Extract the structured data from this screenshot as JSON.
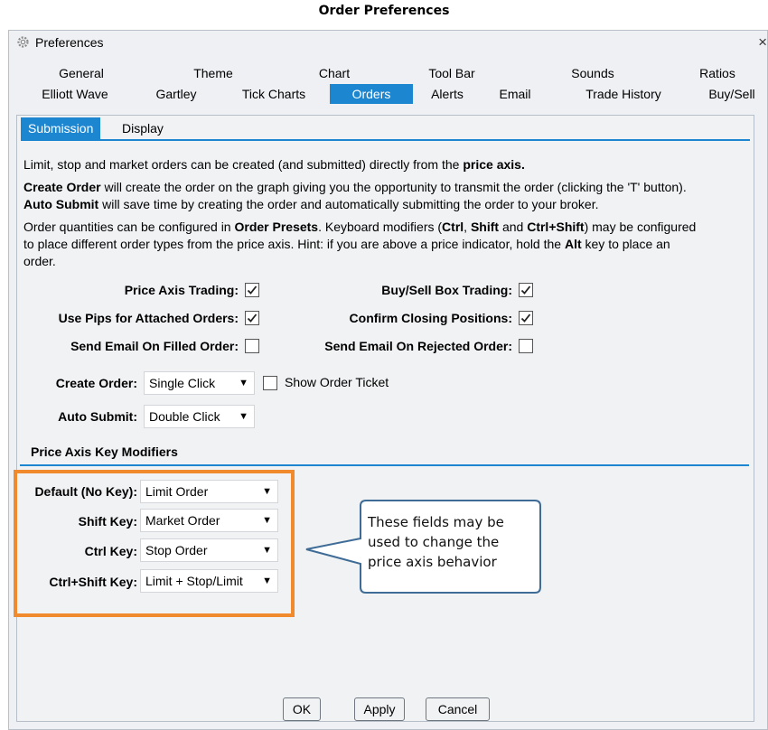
{
  "caption": "Order Preferences",
  "window": {
    "title": "Preferences",
    "close_label": "×"
  },
  "tabs_row1": [
    "General",
    "Theme",
    "Chart",
    "Tool Bar",
    "Sounds",
    "Ratios"
  ],
  "tabs_row2": [
    "Elliott Wave",
    "Gartley",
    "Tick Charts",
    "Orders",
    "Alerts",
    "Email",
    "Trade History",
    "Buy/Sell"
  ],
  "active_tab": "Orders",
  "subtabs": [
    "Submission",
    "Display"
  ],
  "active_subtab": "Submission",
  "para1": {
    "pre": "Limit, stop and market orders can be created (and submitted) directly from the ",
    "bold": "price axis."
  },
  "para2": {
    "b1": "Create Order",
    "t1": " will create the order on the graph giving you the opportunity to transmit the order (clicking the 'T' button).",
    "b2": "Auto Submit",
    "t2": " will save time by creating the order and automatically submitting the order to your broker."
  },
  "para3": {
    "t1": "Order quantities can be configured in ",
    "b1": "Order Presets",
    "t2": ". Keyboard modifiers (",
    "b2": "Ctrl",
    "t3": ", ",
    "b3": "Shift",
    "t4": " and ",
    "b4": "Ctrl+Shift",
    "t5": ") may be configured",
    "t6": "to place different order types from the price axis. Hint: if you are above a price indicator, hold the ",
    "b5": "Alt",
    "t7": " key to place an",
    "t8": "order."
  },
  "options": {
    "price_axis_trading": {
      "label": "Price Axis Trading:",
      "checked": true
    },
    "buy_sell_box_trading": {
      "label": "Buy/Sell Box Trading:",
      "checked": true
    },
    "use_pips": {
      "label": "Use Pips for Attached Orders:",
      "checked": true
    },
    "confirm_closing": {
      "label": "Confirm Closing Positions:",
      "checked": true
    },
    "email_filled": {
      "label": "Send Email On Filled Order:",
      "checked": false
    },
    "email_rejected": {
      "label": "Send Email On Rejected Order:",
      "checked": false
    }
  },
  "create_order": {
    "label": "Create Order:",
    "value": "Single Click",
    "show_ticket_label": "Show Order Ticket",
    "show_ticket_checked": false
  },
  "auto_submit": {
    "label": "Auto Submit:",
    "value": "Double Click"
  },
  "modifiers": {
    "title": "Price Axis Key Modifiers",
    "default": {
      "label": "Default (No Key):",
      "value": "Limit Order"
    },
    "shift": {
      "label": "Shift Key:",
      "value": "Market Order"
    },
    "ctrl": {
      "label": "Ctrl Key:",
      "value": "Stop Order"
    },
    "ctrl_shift": {
      "label": "Ctrl+Shift Key:",
      "value": "Limit + Stop/Limit"
    }
  },
  "callout": {
    "line1": "These fields may be",
    "line2": "used to change the",
    "line3": "price axis behavior"
  },
  "buttons": {
    "ok": "OK",
    "apply": "Apply",
    "cancel": "Cancel"
  },
  "dropdown_arrow": "▼",
  "colors": {
    "accent": "#1d86d1",
    "highlight": "#f08a2c",
    "callout_border": "#3f6c96"
  }
}
